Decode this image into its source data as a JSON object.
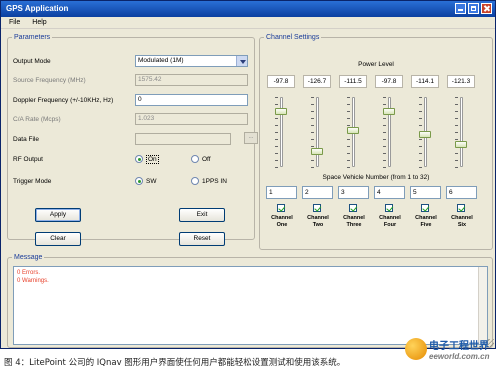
{
  "window": {
    "title": "GPS Application"
  },
  "menu": [
    "File",
    "Help"
  ],
  "parameters": {
    "legend": "Parameters",
    "output_mode": {
      "label": "Output Mode",
      "value": "Modulated (1M)"
    },
    "source_frequency": {
      "label": "Source Frequency (MHz)",
      "value": "1575.42"
    },
    "doppler": {
      "label": "Doppler Frequency (+/-10KHz, Hz)",
      "value": "0"
    },
    "ca_rate": {
      "label": "C/A Rate (Mcps)",
      "value": "1.023"
    },
    "data_file": {
      "label": "Data File",
      "value": "",
      "browse_label": "..."
    },
    "rf_output": {
      "label": "RF Output",
      "options": [
        "On",
        "Off"
      ],
      "selected": "On"
    },
    "trigger_mode": {
      "label": "Trigger Mode",
      "options": [
        "SW",
        "1PPS IN"
      ],
      "selected": "SW"
    }
  },
  "buttons": {
    "apply": "Apply",
    "exit": "Exit",
    "clear": "Clear",
    "reset": "Reset"
  },
  "channel_settings": {
    "legend": "Channel Settings",
    "power_level_header": "Power Level",
    "sv_header": "Space Vehicle Number (from 1 to 32)",
    "channels": [
      {
        "power": "-97.8",
        "sv": "1",
        "name_line1": "Channel",
        "name_line2": "One",
        "checked": true
      },
      {
        "power": "-126.7",
        "sv": "2",
        "name_line1": "Channel",
        "name_line2": "Two",
        "checked": true
      },
      {
        "power": "-111.5",
        "sv": "3",
        "name_line1": "Channel",
        "name_line2": "Three",
        "checked": true
      },
      {
        "power": "-97.8",
        "sv": "4",
        "name_line1": "Channel",
        "name_line2": "Four",
        "checked": true
      },
      {
        "power": "-114.1",
        "sv": "5",
        "name_line1": "Channel",
        "name_line2": "Five",
        "checked": true
      },
      {
        "power": "-121.3",
        "sv": "6",
        "name_line1": "Channel",
        "name_line2": "Six",
        "checked": true
      }
    ]
  },
  "message": {
    "legend": "Message",
    "lines": [
      "0 Errors.",
      "0 Warnings."
    ]
  },
  "caption": "图 4：LitePoint 公司的 IQnav 图形用户界面使任何用户都能轻松设置测试和使用该系统。",
  "watermark": {
    "cn": "电子工程世界",
    "en": "eeworld.com.cn"
  },
  "colors": {
    "titlebar": "#0b3fa0",
    "window_bg": "#ece9d8",
    "group_label": "#1a3c99",
    "message_text": "#e8402a",
    "check": "#21a121"
  }
}
